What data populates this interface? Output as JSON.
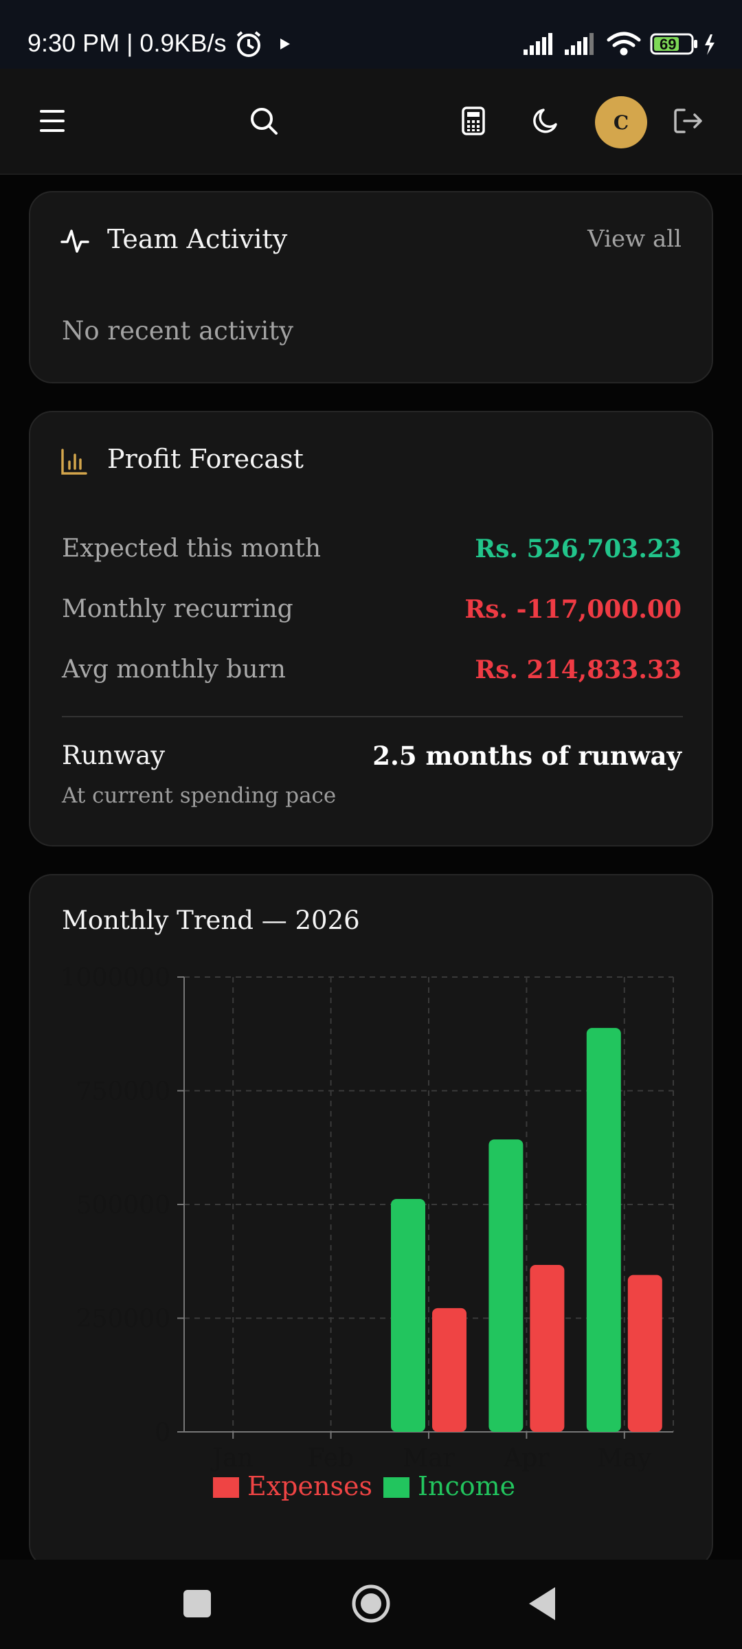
{
  "status_bar": {
    "time_speed": "9:30 PM | 0.9KB/s",
    "battery": "69"
  },
  "header": {
    "avatar_initial": "C"
  },
  "team_activity": {
    "title": "Team Activity",
    "view_all": "View all",
    "empty_text": "No recent activity"
  },
  "profit_forecast": {
    "title": "Profit Forecast",
    "rows": [
      {
        "label": "Expected this month",
        "value": "Rs. 526,703.23",
        "color": "#22c58b"
      },
      {
        "label": "Monthly recurring",
        "value": "Rs. -117,000.00",
        "color": "#ef3b44"
      },
      {
        "label": "Avg monthly burn",
        "value": "Rs. 214,833.33",
        "color": "#ef3b44"
      }
    ],
    "runway_label": "Runway",
    "runway_value": "2.5 months of runway",
    "runway_sub": "At current spending pace"
  },
  "monthly_trend": {
    "title": "Monthly Trend — 2026"
  },
  "chart_data": {
    "type": "bar",
    "categories": [
      "Jan",
      "Feb",
      "Mar",
      "Apr",
      "May"
    ],
    "series": [
      {
        "name": "Income",
        "color": "#22c55e",
        "values": [
          0,
          0,
          512000,
          643000,
          888000
        ]
      },
      {
        "name": "Expenses",
        "color": "#ef4444",
        "values": [
          0,
          0,
          272000,
          367000,
          345000
        ]
      }
    ],
    "legend_order": [
      "Expenses",
      "Income"
    ],
    "legend_placement": "bottom",
    "yticks": [
      "0",
      "250000",
      "500000",
      "750000",
      "1000000"
    ],
    "ylim": [
      0,
      1000000
    ],
    "grid": true
  }
}
